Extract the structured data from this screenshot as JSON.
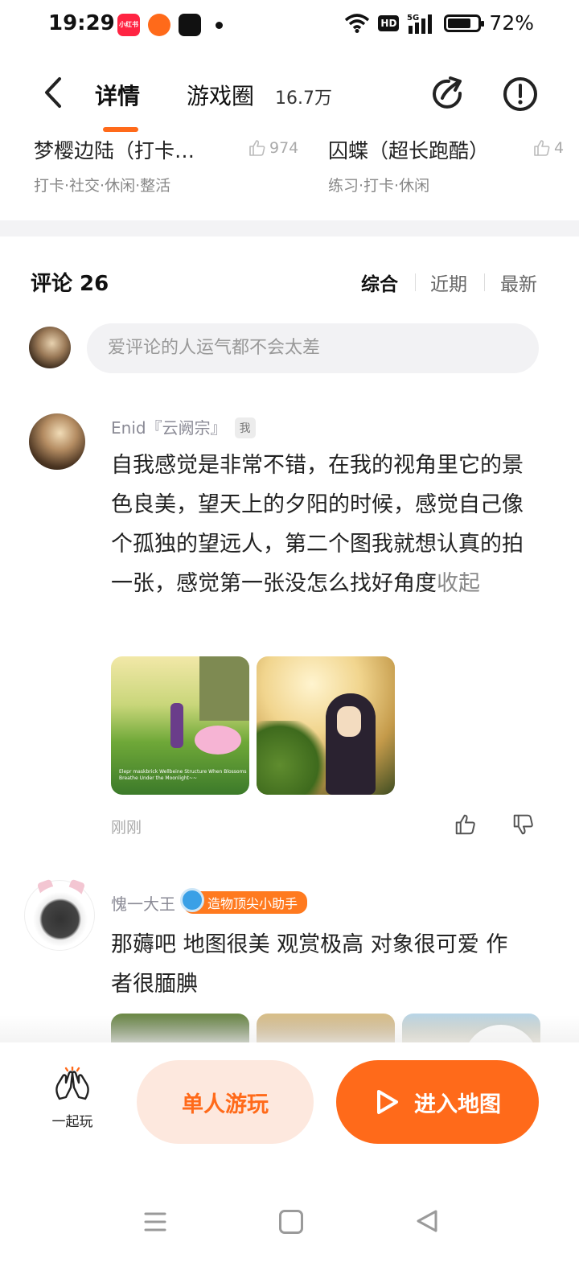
{
  "status_bar": {
    "time": "19:29",
    "app1_label": "小红书",
    "hd": "HD",
    "network": "5G",
    "battery": "72%"
  },
  "header": {
    "tab_detail": "详情",
    "tab_circle": "游戏圈",
    "circle_count": "16.7万",
    "accent_color": "#ff6a1a"
  },
  "related": [
    {
      "title": "梦樱边陆（打卡…",
      "tags": "打卡·社交·休闲·整活",
      "likes": "974"
    },
    {
      "title": "囚蝶（超长跑酷）",
      "tags": "练习·打卡·休闲",
      "likes": "4"
    }
  ],
  "comments_section": {
    "title": "评论 26",
    "sort_options": [
      "综合",
      "近期",
      "最新"
    ],
    "active_sort": "综合",
    "input_placeholder": "爱评论的人运气都不会太差"
  },
  "comments": [
    {
      "author": "Enid『云阙宗』",
      "tag": "我",
      "text": "自我感觉是非常不错，在我的视角里它的景色良美，望天上的夕阳的时候，感觉自己像个孤独的望远人，第二个图我就想认真的拍一张，感觉第一张没怎么找好角度",
      "collapse_label": "收起",
      "image1_caption": "Elepr maskbrick Wellbeine Structure\nWhen Blossoms Breathe Under the Moonlight~~",
      "time": "刚刚"
    },
    {
      "author": "愧一大王",
      "badge": "造物顶尖小助手",
      "text": "那薅吧 地图很美 观赏极高 对象很可爱 作者很腼腆"
    }
  ],
  "bottom_bar": {
    "play_together": "一起玩",
    "solo_play": "单人游玩",
    "enter_map": "进入地图"
  }
}
